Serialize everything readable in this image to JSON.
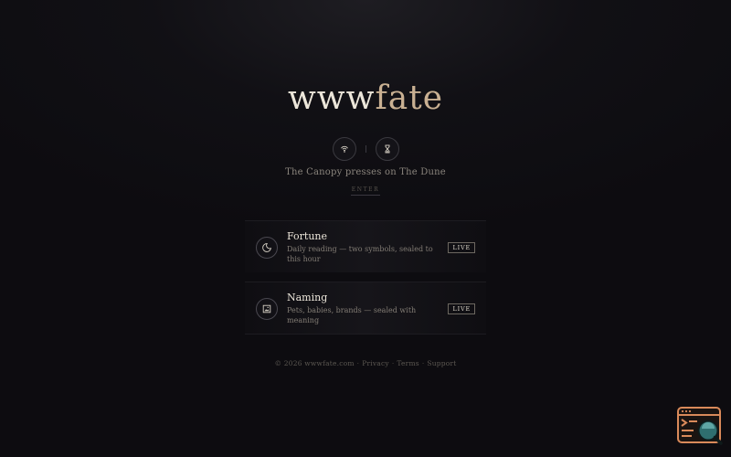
{
  "brand": {
    "part1": "www",
    "part2": "fate"
  },
  "icons": {
    "left": "broadcast-icon",
    "right": "hourglass-icon"
  },
  "subtitle": "The Canopy presses on The Dune",
  "enter_label": "ENTER",
  "cards": [
    {
      "title": "Fortune",
      "description": "Daily reading — two symbols, sealed to this hour",
      "badge": "LIVE",
      "icon": "crescent-moon-icon"
    },
    {
      "title": "Naming",
      "description": "Pets, babies, brands — sealed with meaning",
      "badge": "LIVE",
      "icon": "image-frame-icon"
    }
  ],
  "footer": {
    "copyright": "© 2026 wwwfate.com",
    "privacy": "Privacy",
    "terms": "Terms",
    "support": "Support"
  },
  "widget": {
    "icon": "code-inspect-icon"
  },
  "colors": {
    "background": "#0d0c10",
    "brand_light": "#ece6da",
    "brand_accent": "#c9b092",
    "widget_orange": "#d98a5a",
    "widget_teal": "#2f6f6f"
  }
}
